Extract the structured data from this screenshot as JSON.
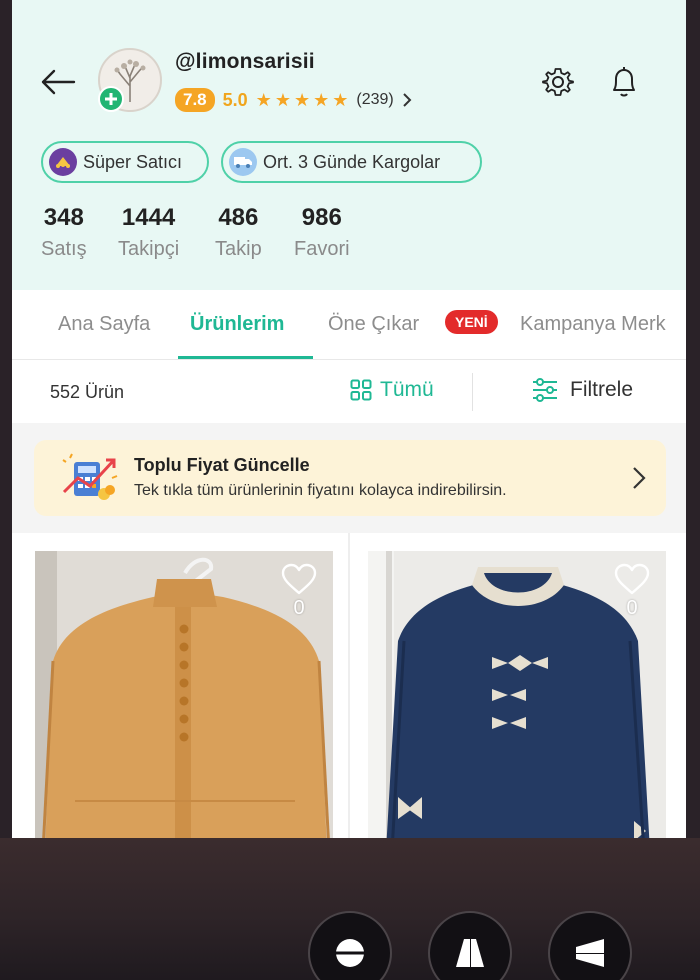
{
  "profile": {
    "username": "@limonsarisii",
    "score": "7.8",
    "rating": "5.0",
    "stars": 5,
    "review_count": "(239)"
  },
  "badges": [
    {
      "label": "Süper Satıcı",
      "icon": "crown-stars-icon"
    },
    {
      "label": "Ort. 3 Günde Kargolar",
      "icon": "truck-icon"
    }
  ],
  "stats": [
    {
      "value": "348",
      "label": "Satış"
    },
    {
      "value": "1444",
      "label": "Takipçi"
    },
    {
      "value": "486",
      "label": "Takip"
    },
    {
      "value": "986",
      "label": "Favori"
    }
  ],
  "tabs": [
    {
      "label": "Ana Sayfa"
    },
    {
      "label": "Ürünlerim",
      "active": true
    },
    {
      "label": "Öne Çıkar"
    },
    {
      "label": "Kampanya Merk"
    }
  ],
  "new_badge": "YENİ",
  "filter_bar": {
    "count": "552 Ürün",
    "all_label": "Tümü",
    "filter_label": "Filtrele"
  },
  "promo": {
    "title": "Toplu Fiyat Güncelle",
    "description": "Tek tıkla tüm ürünlerinin fiyatını kolayca indirebilirsin."
  },
  "products": [
    {
      "likes": "0",
      "color": "#d9a05a"
    },
    {
      "likes": "0",
      "color": "#243a63"
    }
  ],
  "colors": {
    "accent": "#1fb894",
    "header_bg": "#e8f8f4",
    "star": "#f5a524",
    "badge_red": "#e32b2b",
    "promo_bg": "#fdf3d8"
  }
}
